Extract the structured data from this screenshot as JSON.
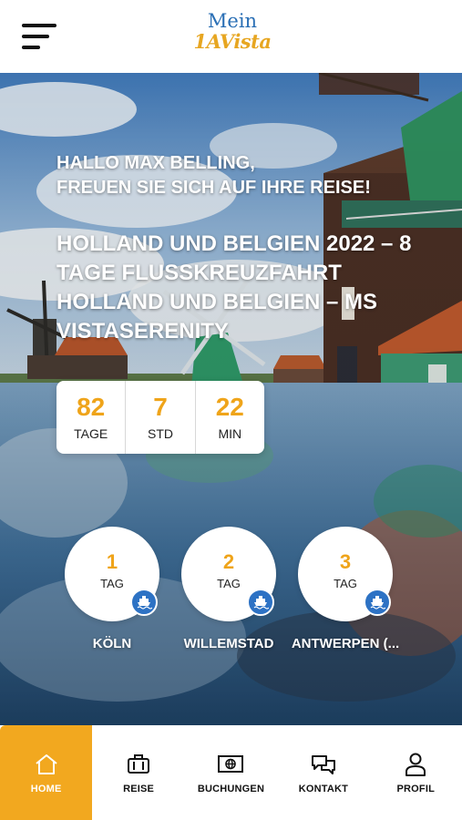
{
  "header": {
    "logo_top": "Mein",
    "logo_bottom": "1AVista"
  },
  "hero": {
    "greeting_line1": "HALLO MAX BELLING,",
    "greeting_line2": "FREUEN SIE SICH AUF IHRE REISE!",
    "trip_title": "HOLLAND UND BELGIEN 2022 – 8 TAGE FLUSSKREUZFAHRT HOLLAND UND BELGIEN – MS VISTASERENITY"
  },
  "countdown": [
    {
      "value": "82",
      "label": "TAGE"
    },
    {
      "value": "7",
      "label": "STD"
    },
    {
      "value": "22",
      "label": "MIN"
    }
  ],
  "days": [
    {
      "number": "1",
      "label": "TAG",
      "city": "KÖLN",
      "icon": "ship-icon"
    },
    {
      "number": "2",
      "label": "TAG",
      "city": "WILLEMSTAD",
      "icon": "ship-icon"
    },
    {
      "number": "3",
      "label": "TAG",
      "city": "ANTWERPEN (...",
      "icon": "ship-icon"
    }
  ],
  "nav": [
    {
      "label": "HOME",
      "icon": "home-icon",
      "active": true
    },
    {
      "label": "REISE",
      "icon": "suitcase-icon",
      "active": false
    },
    {
      "label": "BUCHUNGEN",
      "icon": "booking-globe-icon",
      "active": false
    },
    {
      "label": "KONTAKT",
      "icon": "chat-bubbles-icon",
      "active": false
    },
    {
      "label": "PROFIL",
      "icon": "user-icon",
      "active": false
    }
  ],
  "colors": {
    "accent": "#f2a81f",
    "number": "#efa41a",
    "badge": "#2d72c4",
    "logo_blue": "#2a6fb5"
  }
}
